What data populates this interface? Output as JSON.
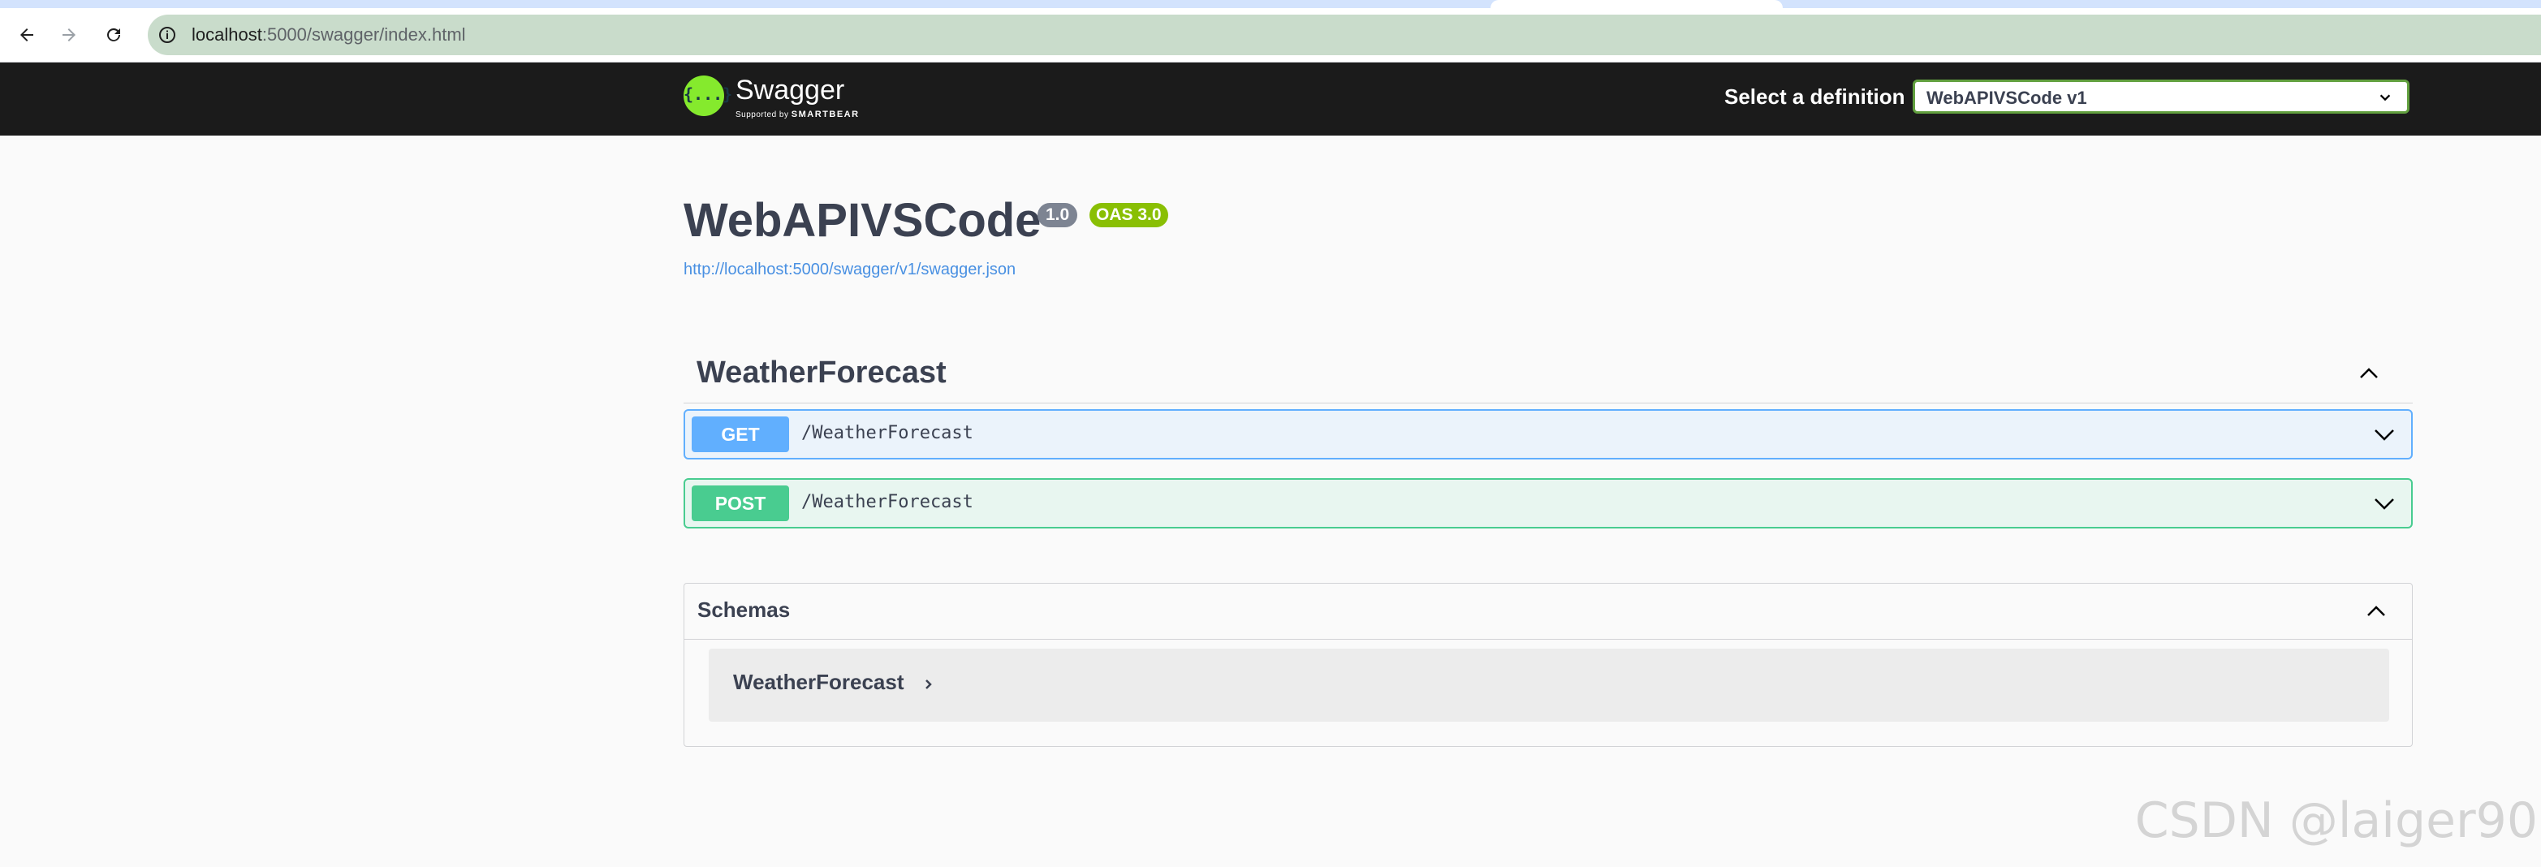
{
  "browser": {
    "url_host": "localhost",
    "url_path": ":5000/swagger/index.html"
  },
  "topbar": {
    "logo_name": "Swagger",
    "logo_mark": "{...}",
    "logo_sub_prefix": "Supported by",
    "logo_sub_brand": "SMARTBEAR",
    "definition_label": "Select a definition",
    "definition_value": "WebAPIVSCode v1"
  },
  "info": {
    "title": "WebAPIVSCode",
    "version_badge": "1.0",
    "oas_badge": "OAS 3.0",
    "spec_url": "http://localhost:5000/swagger/v1/swagger.json"
  },
  "tag": {
    "name": "WeatherForecast",
    "operations": [
      {
        "method": "GET",
        "path": "/WeatherForecast"
      },
      {
        "method": "POST",
        "path": "/WeatherForecast"
      }
    ]
  },
  "schemas": {
    "label": "Schemas",
    "models": [
      {
        "name": "WeatherForecast"
      }
    ]
  },
  "watermark": "CSDN @laiger90",
  "colors": {
    "get": "#61affe",
    "post": "#49cc90",
    "topbar": "#1b1b1b",
    "logo": "#85ea2d",
    "oas_badge": "#89bf04",
    "version_badge": "#7d8492",
    "select_border": "#62a03f"
  },
  "icons": {
    "back": "arrow-left-icon",
    "forward": "arrow-right-icon",
    "reload": "reload-icon",
    "site_info": "info-circle-icon",
    "collapse": "chevron-up-icon",
    "expand": "chevron-down-icon",
    "model_expand": "chevron-right-icon"
  }
}
